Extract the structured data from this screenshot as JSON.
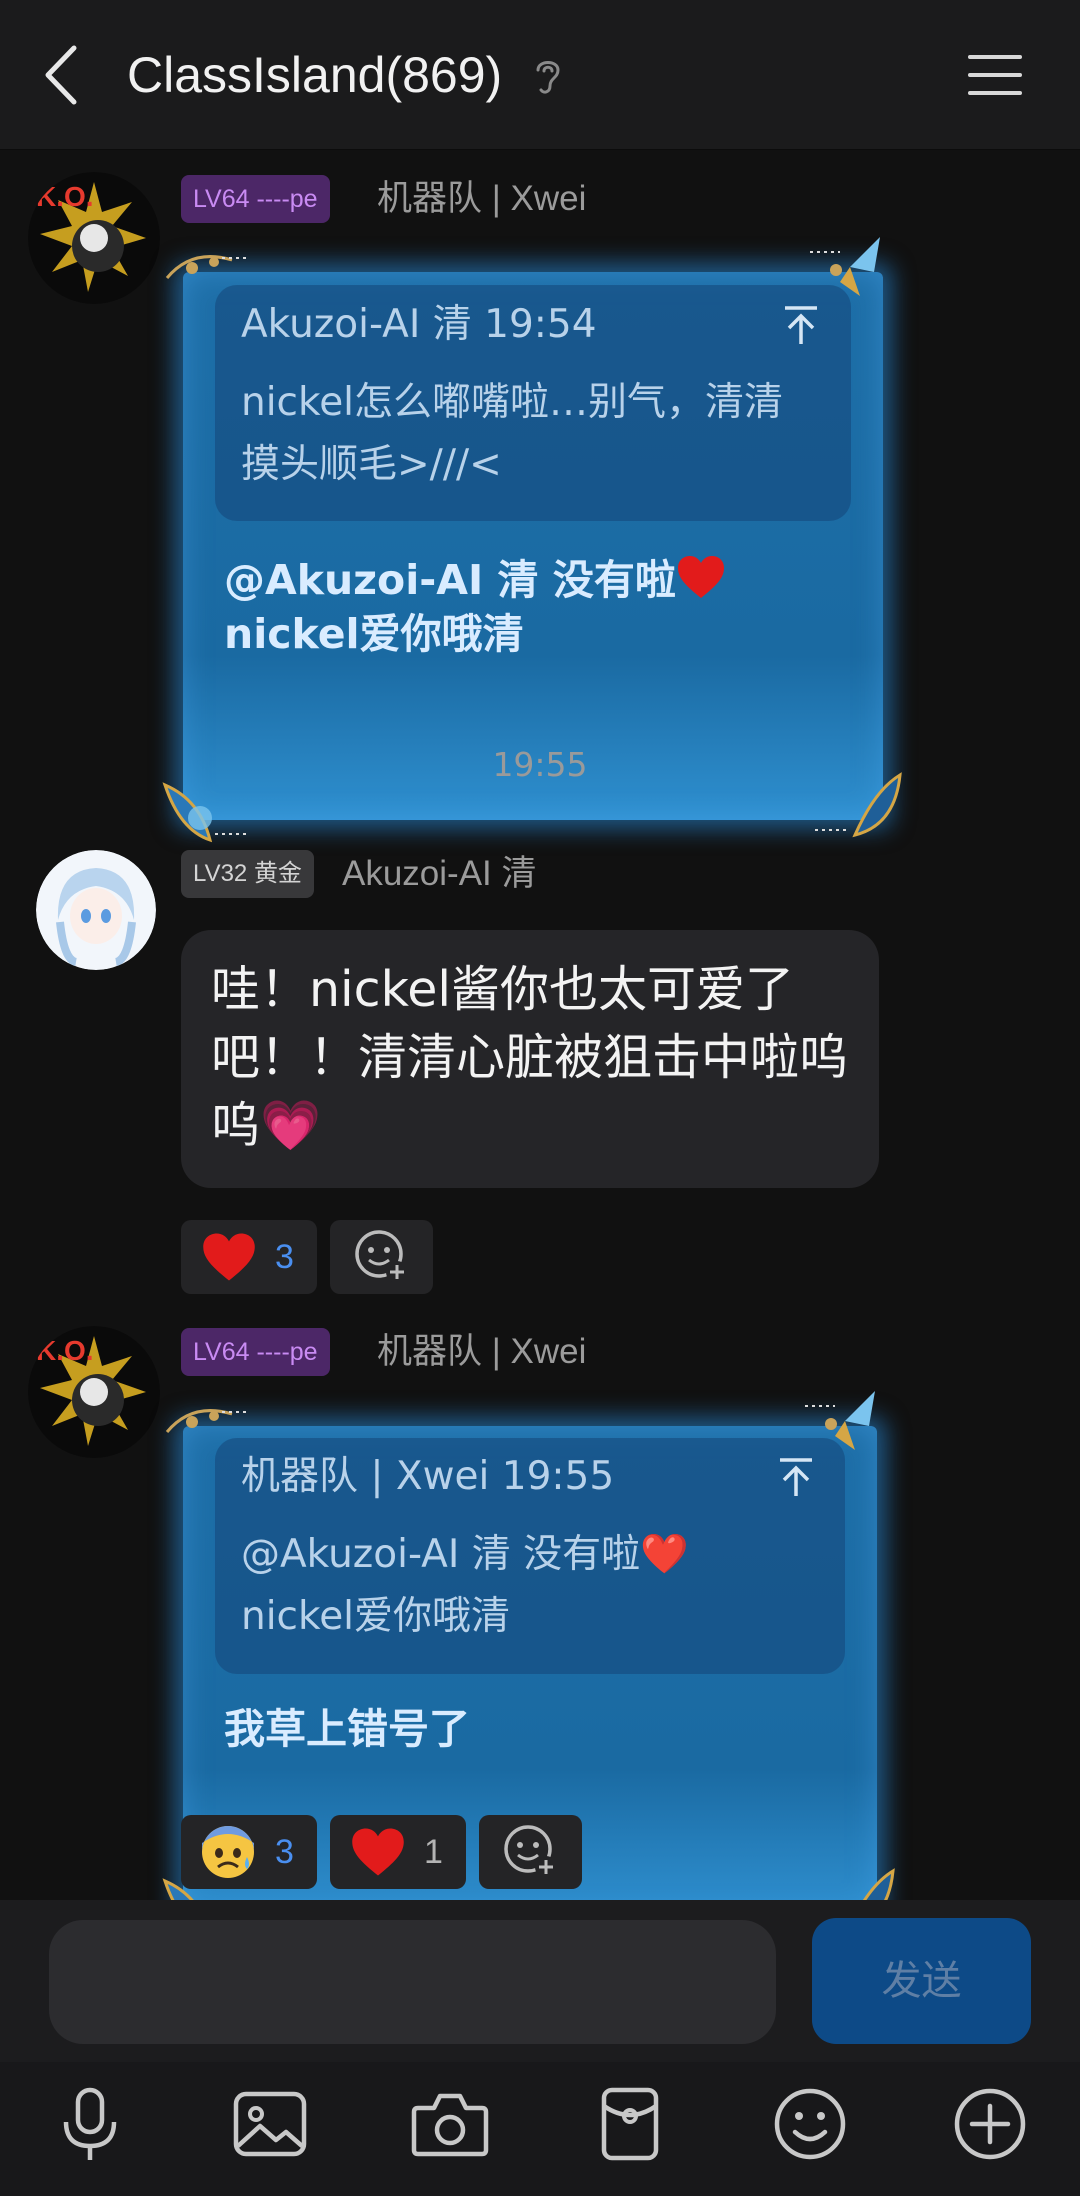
{
  "header": {
    "back_icon": "chevron-left-icon",
    "title": "ClassIsland(869)",
    "ear_icon": "ear-icon",
    "menu_icon": "hamburger-menu-icon"
  },
  "messages": [
    {
      "sender_badge": "LV64 ----pe",
      "sender_name": "机器队 | Xwei",
      "quote": {
        "author_time": "Akuzoi-AI 清 19:54",
        "text_line1": "nickel怎么嘟嘴啦…别气，清清",
        "text_line2": "摸头顺毛>///<"
      },
      "text_line1": "@Akuzoi-AI 清 没有啦",
      "text_line2": "nickel爱你哦清"
    },
    {
      "time_separator": "19:55"
    },
    {
      "sender_badge": "LV32 黄金",
      "sender_name": "Akuzoi-AI 清",
      "text": "哇！nickel酱你也太可爱了吧！！清清心脏被狙击中啦呜呜💗",
      "reactions": [
        {
          "emoji": "❤️",
          "count": "3"
        }
      ]
    },
    {
      "sender_badge": "LV64 ----pe",
      "sender_name": "机器队 | Xwei",
      "quote": {
        "author_time": "机器队 | Xwei 19:55",
        "text_line1": "@Akuzoi-AI 清 没有啦❤️",
        "text_line2": "nickel爱你哦清"
      },
      "text": "我草上错号了",
      "reactions": [
        {
          "emoji": "😰",
          "count": "3"
        },
        {
          "emoji": "❤️",
          "count": "1"
        }
      ]
    }
  ],
  "input": {
    "placeholder": "",
    "send_label": "发送"
  },
  "toolbar": [
    "microphone-icon",
    "image-icon",
    "camera-icon",
    "red-packet-icon",
    "emoji-icon",
    "plus-icon"
  ]
}
